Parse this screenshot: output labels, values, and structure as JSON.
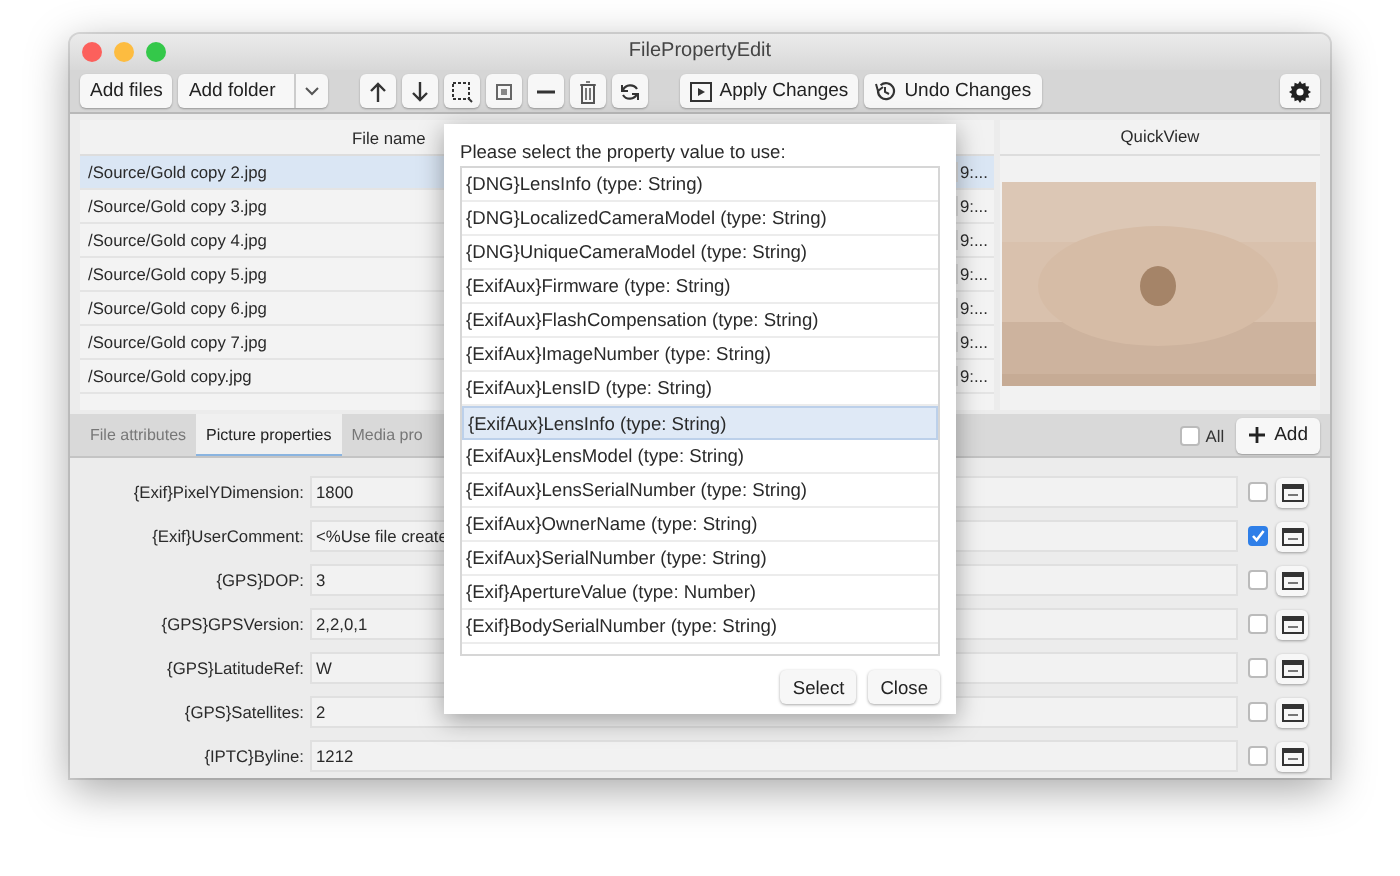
{
  "window": {
    "title": "FilePropertyEdit"
  },
  "toolbar": {
    "buttons": [
      {
        "label": "Add files",
        "kind": "plain"
      },
      {
        "label": "Add folder",
        "kind": "split"
      }
    ],
    "actions": [
      {
        "label": "Apply Changes",
        "kind": "apply"
      },
      {
        "label": "Undo Changes",
        "kind": "undo"
      }
    ]
  },
  "file_table": {
    "columns": [
      "File name"
    ],
    "rows": [
      {
        "file": "/Source/Gold copy 2.jpg",
        "column_2": "9:...",
        "selected": true
      },
      {
        "file": "/Source/Gold copy 3.jpg",
        "column_2": "9:...",
        "selected": false
      },
      {
        "file": "/Source/Gold copy 4.jpg",
        "column_2": "9:...",
        "selected": false
      },
      {
        "file": "/Source/Gold copy 5.jpg",
        "column_2": "9:...",
        "selected": false
      },
      {
        "file": "/Source/Gold copy 6.jpg",
        "column_2": "9:...",
        "selected": false
      },
      {
        "file": "/Source/Gold copy 7.jpg",
        "column_2": "9:...",
        "selected": false
      },
      {
        "file": "/Source/Gold copy.jpg",
        "column_2": "9:...",
        "selected": false
      }
    ]
  },
  "quickview": {
    "title": "QuickView",
    "kind": "picture"
  },
  "tabs": [
    {
      "label": "File attributes",
      "selected": false
    },
    {
      "label": "Picture properties",
      "selected": true
    },
    {
      "label": "Media pro",
      "selected": false
    }
  ],
  "all_checkbox": {
    "label": "All",
    "checked": false
  },
  "add_button": {
    "label": "Add"
  },
  "properties": [
    {
      "name": "{Exif}PixelYDimension:",
      "value": "1800",
      "checked": false
    },
    {
      "name": "{Exif}UserComment:",
      "value": "<%Use file create",
      "checked": true
    },
    {
      "name": "{GPS}DOP:",
      "value": "3",
      "checked": false
    },
    {
      "name": "{GPS}GPSVersion:",
      "value": "2,2,0,1",
      "checked": false
    },
    {
      "name": "{GPS}LatitudeRef:",
      "value": "W",
      "checked": false
    },
    {
      "name": "{GPS}Satellites:",
      "value": "2",
      "checked": false
    },
    {
      "name": "{IPTC}Byline:",
      "value": "1212",
      "checked": false
    }
  ],
  "dialog": {
    "prompt": "Please select the property value to use:",
    "options": [
      {
        "label": "{DNG}LensInfo (type: String)",
        "selected": false
      },
      {
        "label": "{DNG}LocalizedCameraModel (type: String)",
        "selected": false
      },
      {
        "label": "{DNG}UniqueCameraModel (type: String)",
        "selected": false
      },
      {
        "label": "{ExifAux}Firmware (type: String)",
        "selected": false
      },
      {
        "label": "{ExifAux}FlashCompensation (type: String)",
        "selected": false
      },
      {
        "label": "{ExifAux}ImageNumber (type: String)",
        "selected": false
      },
      {
        "label": "{ExifAux}LensID (type: String)",
        "selected": false
      },
      {
        "label": "{ExifAux}LensInfo (type: String)",
        "selected": true
      },
      {
        "label": "{ExifAux}LensModel (type: String)",
        "selected": false
      },
      {
        "label": "{ExifAux}LensSerialNumber (type: String)",
        "selected": false
      },
      {
        "label": "{ExifAux}OwnerName (type: String)",
        "selected": false
      },
      {
        "label": "{ExifAux}SerialNumber (type: String)",
        "selected": false
      },
      {
        "label": "{Exif}ApertureValue (type: Number)",
        "selected": false
      },
      {
        "label": "{Exif}BodySerialNumber (type: String)",
        "selected": false
      }
    ],
    "buttons": [
      "Select",
      "Close"
    ]
  }
}
